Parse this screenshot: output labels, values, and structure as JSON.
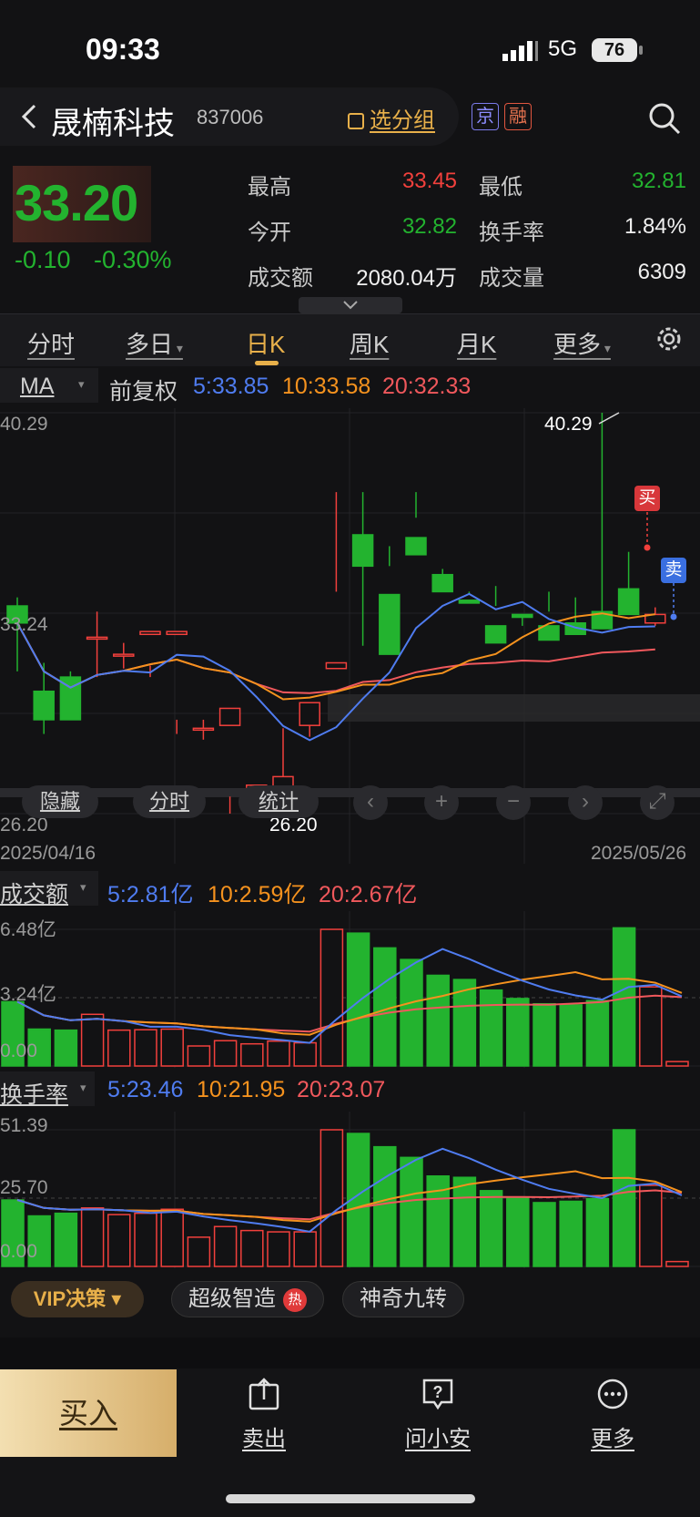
{
  "status": {
    "time": "09:33",
    "network": "5G",
    "battery": "76"
  },
  "header": {
    "name": "晟楠科技",
    "code": "837006",
    "group_btn": "选分组",
    "tag_jing": "京",
    "tag_rong": "融"
  },
  "quote": {
    "price": "33.20",
    "change": "-0.10",
    "change_pct": "-0.30%",
    "high_label": "最高",
    "high": "33.45",
    "low_label": "最低",
    "low": "32.81",
    "open_label": "今开",
    "open": "32.82",
    "turnover_label": "换手率",
    "turnover": "1.84%",
    "amount_label": "成交额",
    "amount": "2080.04万",
    "volume_label": "成交量",
    "volume": "6309"
  },
  "tabs": [
    "分时",
    "多日",
    "日K",
    "周K",
    "月K",
    "更多"
  ],
  "active_tab": "日K",
  "kline": {
    "indicator": "MA",
    "adjust": "前复权",
    "ma5": "5:33.85",
    "ma10": "10:33.58",
    "ma20": "20:32.33",
    "axis_max": "40.29",
    "axis_mid": "33.24",
    "axis_min": "26.20",
    "max_label": "40.29",
    "min_label": "26.20",
    "date_start": "2025/04/16",
    "date_end": "2025/05/26",
    "buy_tag": "买",
    "sell_tag": "卖",
    "controls": {
      "hide": "隐藏",
      "fenshi": "分时",
      "stats": "统计"
    }
  },
  "volume_panel": {
    "label": "成交额",
    "ma5": "5:2.81亿",
    "ma10": "10:2.59亿",
    "ma20": "20:2.67亿",
    "axis_max": "6.48亿",
    "axis_mid": "3.24亿",
    "axis_min": "0.00"
  },
  "turnover_panel": {
    "label": "换手率",
    "ma5": "5:23.46",
    "ma10": "10:21.95",
    "ma20": "20:23.07",
    "axis_max": "51.39",
    "axis_mid": "25.70",
    "axis_min": "0.00"
  },
  "chips": {
    "vip": "VIP决策",
    "smart": "超级智造",
    "hot": "热",
    "nine": "神奇九转"
  },
  "bottom": {
    "buy": "买入",
    "sell": "卖出",
    "ask": "问小安",
    "more": "更多"
  },
  "colors": {
    "up": "#f2403c",
    "down": "#23b32f",
    "ma5": "#4f7cf0",
    "ma10": "#f5921e",
    "ma20": "#f0585c",
    "accent": "#e8b04a"
  },
  "chart_data": {
    "type": "candlestick",
    "x": [
      "2025/04/16",
      "",
      "",
      "",
      "",
      "",
      "",
      "",
      "",
      "",
      "",
      "",
      "",
      "",
      "",
      "",
      "",
      "",
      "",
      "",
      "",
      "",
      "",
      "",
      "",
      "2025/05/26"
    ],
    "ohlc": [
      [
        33.5,
        32.9,
        33.8,
        31.2
      ],
      [
        30.5,
        29.5,
        31.5,
        29.0
      ],
      [
        31.0,
        29.5,
        31.2,
        29.8
      ],
      [
        32.4,
        32.4,
        33.3,
        31.0
      ],
      [
        31.8,
        31.8,
        32.2,
        31.3
      ],
      [
        32.5,
        32.6,
        31.4,
        31.0
      ],
      [
        32.5,
        32.6,
        29.0,
        29.5
      ],
      [
        29.2,
        29.2,
        29.5,
        28.8
      ],
      [
        29.3,
        29.9,
        26.2,
        26.8
      ],
      [
        26.6,
        27.2,
        26.2,
        26.9
      ],
      [
        26.8,
        27.5,
        27.2,
        29.2
      ],
      [
        29.3,
        30.1,
        28.9,
        29.9
      ],
      [
        31.3,
        31.5,
        37.5,
        34.0
      ],
      [
        36.0,
        34.9,
        37.5,
        32.1
      ],
      [
        33.9,
        31.8,
        34.9,
        35.6
      ],
      [
        35.9,
        35.3,
        37.5,
        36.6
      ],
      [
        34.6,
        34.0,
        34.3,
        34.8
      ],
      [
        33.7,
        33.6,
        33.9,
        34.0
      ],
      [
        32.8,
        32.2,
        34.2,
        33.5
      ],
      [
        33.2,
        33.1,
        33.2,
        32.8
      ],
      [
        32.8,
        32.3,
        34.0,
        33.3
      ],
      [
        32.9,
        32.5,
        33.8,
        32.6
      ],
      [
        33.3,
        32.7,
        40.29,
        33.3
      ],
      [
        34.1,
        33.2,
        35.4,
        33.8
      ],
      [
        32.9,
        33.2,
        32.8,
        33.45
      ]
    ],
    "amount_unit": "亿",
    "amount": [
      3.05,
      1.75,
      1.7,
      2.45,
      1.7,
      1.72,
      1.75,
      0.95,
      1.2,
      1.05,
      1.18,
      1.1,
      6.48,
      6.3,
      5.6,
      5.05,
      4.3,
      4.1,
      3.6,
      3.2,
      2.95,
      2.9,
      3.1,
      6.55,
      3.75,
      0.21
    ],
    "turnover": [
      25.0,
      19.0,
      20.0,
      22.0,
      19.5,
      20.0,
      21.5,
      11.0,
      15.0,
      13.5,
      13.0,
      13.0,
      51.39,
      50.0,
      45.0,
      41.0,
      34.0,
      33.5,
      28.5,
      26.0,
      24.0,
      24.5,
      25.5,
      51.39,
      30.5,
      1.84
    ]
  }
}
